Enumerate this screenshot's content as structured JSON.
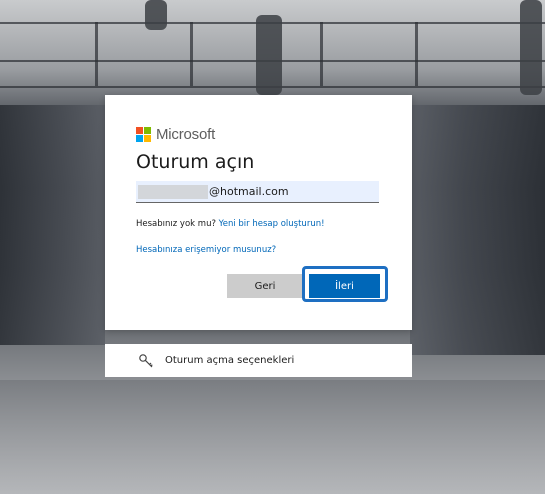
{
  "brand": {
    "name": "Microsoft",
    "colors": [
      "#f25022",
      "#7fba00",
      "#00a4ef",
      "#ffb900"
    ]
  },
  "signin": {
    "title": "Oturum açın",
    "email_suffix": "@hotmail.com",
    "no_account_text": "Hesabınız yok mu?",
    "create_account_link": "Yeni bir hesap oluşturun!",
    "cant_access_link": "Hesabınıza erişemiyor musunuz?",
    "back_button": "Geri",
    "next_button": "İleri"
  },
  "options": {
    "icon": "key-icon",
    "label": "Oturum açma seçenekleri"
  },
  "colors": {
    "accent": "#0067b8",
    "focus_ring": "#1e6fc2",
    "secondary_button": "#cccccc"
  }
}
